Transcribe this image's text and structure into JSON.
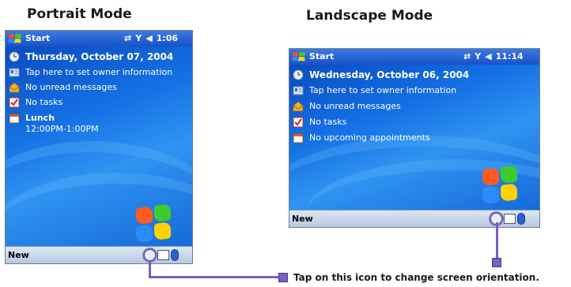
{
  "headings": {
    "portrait": "Portrait Mode",
    "landscape": "Landscape Mode"
  },
  "portrait": {
    "start_label": "Start",
    "time": "1:06",
    "date": "Thursday, October 07, 2004",
    "owner_info": "Tap here to set owner information",
    "messages": "No unread messages",
    "tasks": "No tasks",
    "appointment_title": "Lunch",
    "appointment_time": "12:00PM-1:00PM",
    "new_label": "New"
  },
  "landscape": {
    "start_label": "Start",
    "time": "11:14",
    "date": "Wednesday, October 06, 2004",
    "owner_info": "Tap here to set owner information",
    "messages": "No unread messages",
    "tasks": "No tasks",
    "appointments": "No upcoming appointments",
    "new_label": "New"
  },
  "callout": {
    "text": "Tap on this icon to change screen orientation."
  },
  "colors": {
    "titlebar": "#1752c8",
    "desktop": "#1470e4",
    "bottombar": "#c8d6ea",
    "callout": "#7a5fbf"
  },
  "icons": [
    "windows-logo-icon",
    "sync-icon",
    "signal-icon",
    "speaker-icon",
    "clock-icon",
    "owner-card-icon",
    "inbox-icon",
    "tasks-icon",
    "calendar-icon",
    "screen-orientation-icon",
    "network-icon",
    "bluetooth-icon"
  ]
}
